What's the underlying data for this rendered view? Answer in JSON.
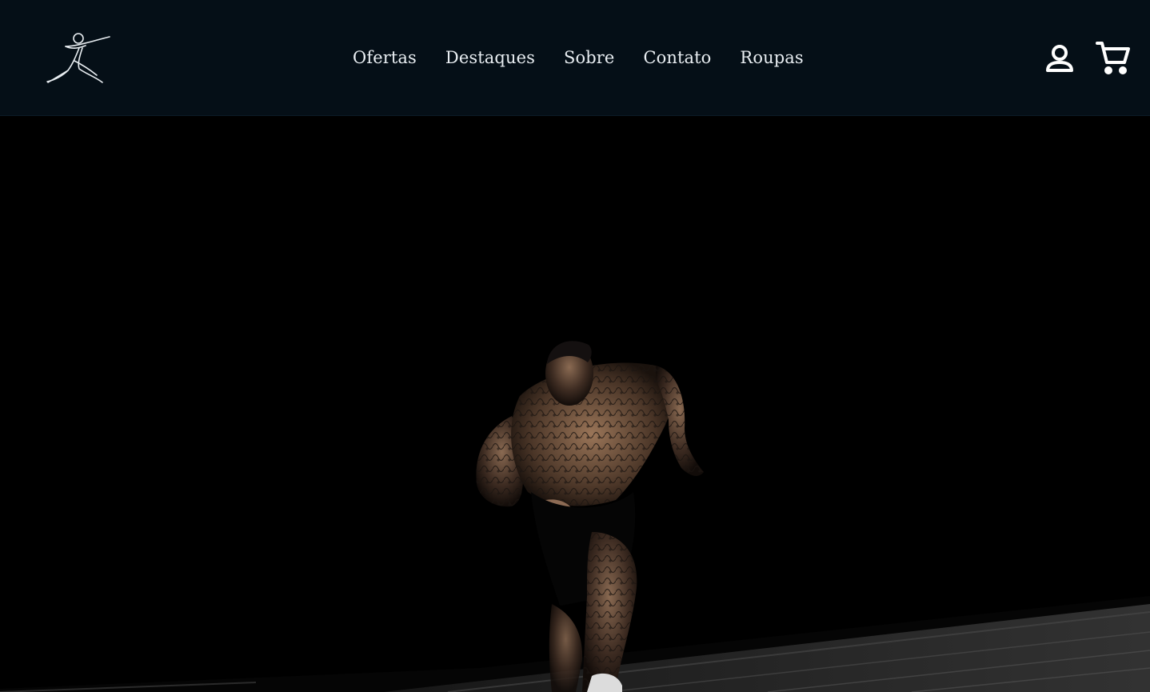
{
  "header": {
    "logo_icon": "running-figure-logo",
    "nav": {
      "items": [
        {
          "label": "Ofertas"
        },
        {
          "label": "Destaques"
        },
        {
          "label": "Sobre"
        },
        {
          "label": "Contato"
        },
        {
          "label": "Roupas"
        }
      ]
    },
    "actions": {
      "account_icon": "user-icon",
      "cart_icon": "shopping-cart-icon"
    }
  },
  "hero": {
    "image": "athlete-sprinting-dark-photo"
  },
  "colors": {
    "header_bg": "#050f17",
    "nav_text": "#e9eef2",
    "hero_bg": "#000000"
  }
}
